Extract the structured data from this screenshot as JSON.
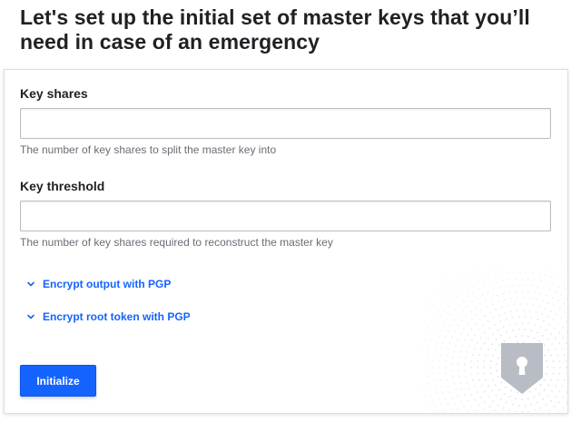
{
  "page": {
    "title": "Let's set up the initial set of master keys that you’ll need in case of an emergency"
  },
  "form": {
    "key_shares": {
      "label": "Key shares",
      "value": "",
      "help": "The number of key shares to split the master key into"
    },
    "key_threshold": {
      "label": "Key threshold",
      "value": "",
      "help": "The number of key shares required to reconstruct the master key"
    },
    "toggles": [
      {
        "label": "Encrypt output with PGP",
        "icon": "chevron-down-icon"
      },
      {
        "label": "Encrypt root token with PGP",
        "icon": "chevron-down-icon"
      }
    ],
    "submit_label": "Initialize"
  },
  "decoration": {
    "illustration_icon": "lock-shield-icon"
  },
  "colors": {
    "accent": "#1563ff",
    "text": "#1f2124",
    "muted_text": "#6a6d75",
    "border": "#b9bcc3",
    "shield": "#b7bcc5"
  }
}
